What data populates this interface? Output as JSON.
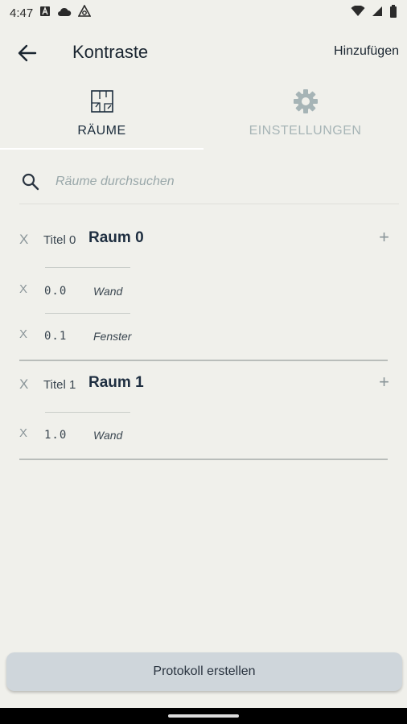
{
  "status_bar": {
    "time": "4:47",
    "left_icons": [
      "notification-a-icon",
      "cloud-icon",
      "vpn-icon"
    ],
    "right_icons": [
      "wifi-icon",
      "signal-icon",
      "battery-icon"
    ]
  },
  "app_bar": {
    "title": "Kontraste",
    "action_label": "Hinzufügen",
    "back_icon": "back-arrow-icon"
  },
  "tabs": [
    {
      "label": "RÄUME",
      "icon": "floorplan-icon",
      "selected": true
    },
    {
      "label": "EINSTELLUNGEN",
      "icon": "gear-icon",
      "selected": false
    }
  ],
  "search": {
    "placeholder": "Räume durchsuchen",
    "icon": "search-icon"
  },
  "rooms": [
    {
      "remove": "X",
      "title_label": "Titel 0",
      "name": "Raum 0",
      "add": "+",
      "items": [
        {
          "remove": "X",
          "number": "0.0",
          "type": "Wand"
        },
        {
          "remove": "X",
          "number": "0.1",
          "type": "Fenster"
        }
      ]
    },
    {
      "remove": "X",
      "title_label": "Titel 1",
      "name": "Raum 1",
      "add": "+",
      "items": [
        {
          "remove": "X",
          "number": "1.0",
          "type": "Wand"
        }
      ]
    }
  ],
  "footer": {
    "button_label": "Protokoll erstellen"
  },
  "colors": {
    "background": "#f0f0eb",
    "primary_text": "#1a2530",
    "inactive_tab": "#a6b4b6",
    "button_bg": "#cfd6db"
  }
}
